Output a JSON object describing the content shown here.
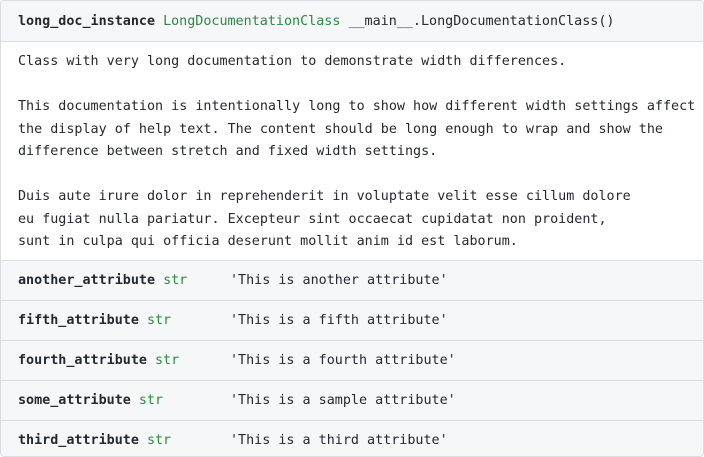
{
  "header": {
    "var_name": "long_doc_instance",
    "class_name": "LongDocumentationClass",
    "repr": "__main__.LongDocumentationClass()"
  },
  "doc": {
    "paragraphs": [
      "Class with very long documentation to demonstrate width differences.",
      "This documentation is intentionally long to show how different width settings affect\nthe display of help text. The content should be long enough to wrap and show the\ndifference between stretch and fixed width settings.",
      "Duis aute irure dolor in reprehenderit in voluptate velit esse cillum dolore\neu fugiat nulla pariatur. Excepteur sint occaecat cupidatat non proident,\nsunt in culpa qui officia deserunt mollit anim id est laborum."
    ]
  },
  "attributes": [
    {
      "name": "another_attribute",
      "type": "str",
      "value": "'This is another attribute'"
    },
    {
      "name": "fifth_attribute",
      "type": "str",
      "value": "'This is a fifth attribute'"
    },
    {
      "name": "fourth_attribute",
      "type": "str",
      "value": "'This is a fourth attribute'"
    },
    {
      "name": "some_attribute",
      "type": "str",
      "value": "'This is a sample attribute'"
    },
    {
      "name": "third_attribute",
      "type": "str",
      "value": "'This is a third attribute'"
    }
  ],
  "colors": {
    "type_green": "#2b8a3e",
    "header_bg": "#f6f7f9",
    "border": "#d9dde2",
    "text": "#24292f"
  }
}
